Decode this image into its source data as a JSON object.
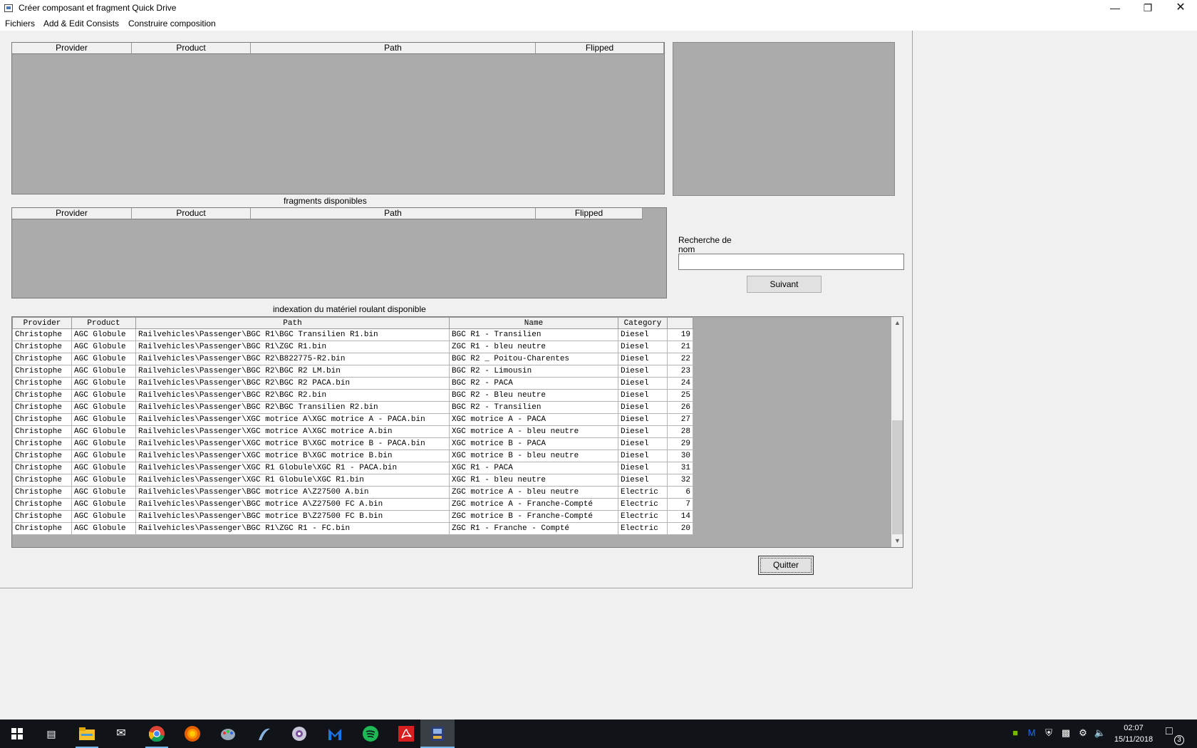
{
  "window": {
    "title": "Créer composant et fragment Quick Drive"
  },
  "menu": [
    {
      "label": "Fichiers"
    },
    {
      "label": "Add & Edit Consists"
    },
    {
      "label": "Construire composition"
    }
  ],
  "consist_table": {
    "columns": [
      "Provider",
      "Product",
      "Path",
      "Flipped"
    ]
  },
  "fragments": {
    "caption": "fragments disponibles",
    "columns": [
      "Provider",
      "Product",
      "Path",
      "Flipped"
    ]
  },
  "search": {
    "label": "Recherche de nom",
    "value": "",
    "next_button": "Suivant"
  },
  "rolling_stock": {
    "caption": "indexation du matériel roulant disponible",
    "columns": [
      "Provider",
      "Product",
      "Path",
      "Name",
      "Category",
      ""
    ],
    "rows": [
      [
        "Christophe",
        "AGC Globule",
        "Railvehicles\\Passenger\\BGC R1\\BGC Transilien R1.bin",
        "BGC R1 - Transilien",
        "Diesel",
        "19"
      ],
      [
        "Christophe",
        "AGC Globule",
        "Railvehicles\\Passenger\\BGC R1\\ZGC R1.bin",
        "ZGC R1 - bleu neutre",
        "Diesel",
        "21"
      ],
      [
        "Christophe",
        "AGC Globule",
        "Railvehicles\\Passenger\\BGC R2\\B822775-R2.bin",
        "BGC R2 _ Poitou-Charentes",
        "Diesel",
        "22"
      ],
      [
        "Christophe",
        "AGC Globule",
        "Railvehicles\\Passenger\\BGC R2\\BGC R2 LM.bin",
        "BGC R2 - Limousin",
        "Diesel",
        "23"
      ],
      [
        "Christophe",
        "AGC Globule",
        "Railvehicles\\Passenger\\BGC R2\\BGC R2 PACA.bin",
        "BGC R2 - PACA",
        "Diesel",
        "24"
      ],
      [
        "Christophe",
        "AGC Globule",
        "Railvehicles\\Passenger\\BGC R2\\BGC R2.bin",
        "BGC R2 - Bleu neutre",
        "Diesel",
        "25"
      ],
      [
        "Christophe",
        "AGC Globule",
        "Railvehicles\\Passenger\\BGC R2\\BGC Transilien R2.bin",
        "BGC R2 - Transilien",
        "Diesel",
        "26"
      ],
      [
        "Christophe",
        "AGC Globule",
        "Railvehicles\\Passenger\\XGC motrice A\\XGC motrice A - PACA.bin",
        "XGC motrice A - PACA",
        "Diesel",
        "27"
      ],
      [
        "Christophe",
        "AGC Globule",
        "Railvehicles\\Passenger\\XGC motrice A\\XGC motrice A.bin",
        "XGC motrice A - bleu neutre",
        "Diesel",
        "28"
      ],
      [
        "Christophe",
        "AGC Globule",
        "Railvehicles\\Passenger\\XGC motrice B\\XGC motrice B - PACA.bin",
        "XGC motrice B - PACA",
        "Diesel",
        "29"
      ],
      [
        "Christophe",
        "AGC Globule",
        "Railvehicles\\Passenger\\XGC motrice B\\XGC motrice B.bin",
        "XGC motrice B - bleu neutre",
        "Diesel",
        "30"
      ],
      [
        "Christophe",
        "AGC Globule",
        "Railvehicles\\Passenger\\XGC R1 Globule\\XGC R1 - PACA.bin",
        "XGC R1 - PACA",
        "Diesel",
        "31"
      ],
      [
        "Christophe",
        "AGC Globule",
        "Railvehicles\\Passenger\\XGC R1 Globule\\XGC R1.bin",
        "XGC R1 - bleu neutre",
        "Diesel",
        "32"
      ],
      [
        "Christophe",
        "AGC Globule",
        "Railvehicles\\Passenger\\BGC motrice A\\Z27500 A.bin",
        "ZGC motrice A - bleu neutre",
        "Electric",
        "6"
      ],
      [
        "Christophe",
        "AGC Globule",
        "Railvehicles\\Passenger\\BGC motrice A\\Z27500 FC A.bin",
        "ZGC motrice A - Franche-Compté",
        "Electric",
        "7"
      ],
      [
        "Christophe",
        "AGC Globule",
        "Railvehicles\\Passenger\\BGC motrice B\\Z27500 FC B.bin",
        "ZGC motrice B - Franche-Compté",
        "Electric",
        "14"
      ],
      [
        "Christophe",
        "AGC Globule",
        "Railvehicles\\Passenger\\BGC R1\\ZGC R1 - FC.bin",
        "ZGC R1 - Franche - Compté",
        "Electric",
        "20"
      ]
    ]
  },
  "quit_button": "Quitter",
  "taskbar": {
    "apps": [
      "start-icon",
      "task-view-icon",
      "file-explorer-icon",
      "mail-icon",
      "chrome-icon",
      "firefox-icon",
      "paint-icon",
      "app-icon",
      "media-icon",
      "malwarebytes-icon",
      "spotify-icon",
      "acrobat-icon",
      "train-app-icon"
    ],
    "time": "02:07",
    "date": "15/11/2018",
    "notifications": "3"
  },
  "colors": {
    "grid_background": "#ababab",
    "taskbar": "#101418",
    "accent": "#76b9ed"
  }
}
